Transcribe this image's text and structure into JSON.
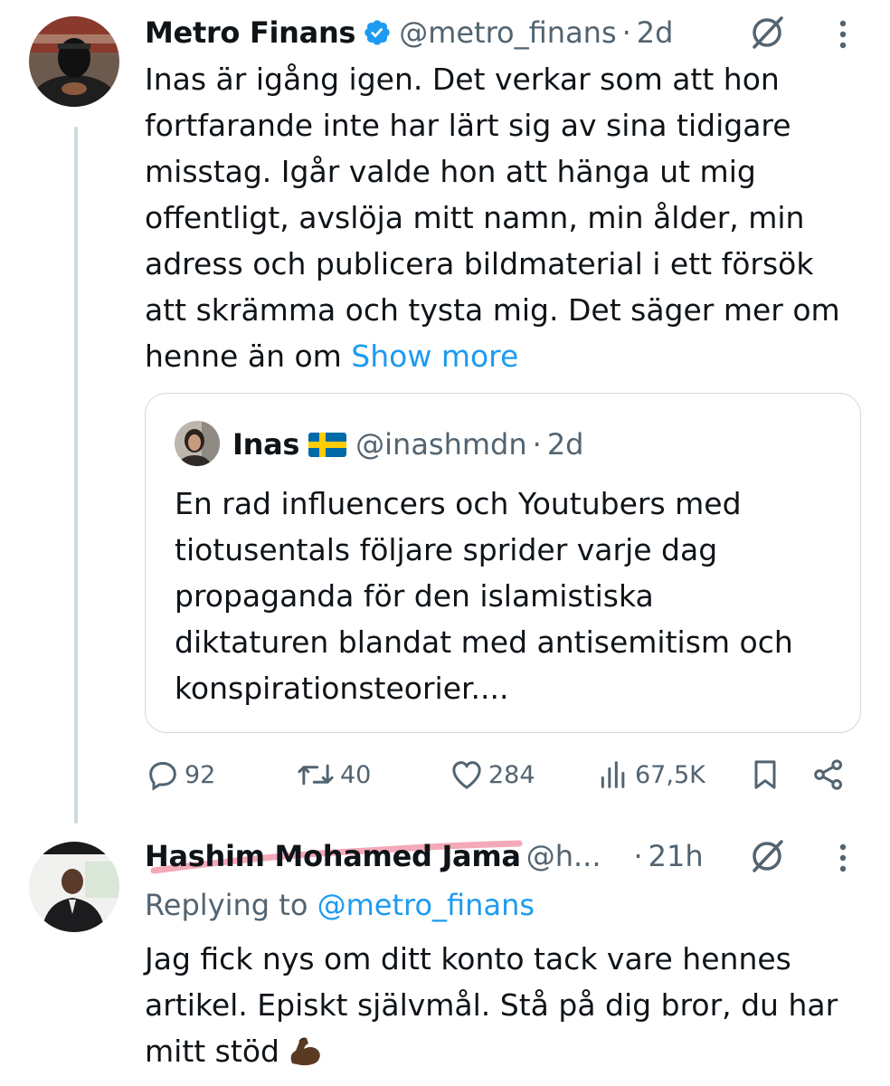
{
  "colors": {
    "link": "#1d9bf0",
    "secondary_text": "#536471",
    "primary_text": "#0f1419",
    "border": "#cfd9de",
    "highlight": "#f08ca0"
  },
  "tweet1": {
    "display_name": "Metro Finans",
    "handle": "@metro_finans",
    "dot": "·",
    "timestamp": "2d",
    "avatar_icon": "masked-person-avatar",
    "body": "Inas är igång igen. Det verkar som att hon\nfortfarande inte har lärt sig av sina tidigare\nmisstag. Igår valde hon att hänga ut mig\noffentligt, avslöja mitt namn, min ålder, min\nadress och publicera bildmaterial i ett försök\natt skrämma och tysta mig. Det säger mer om\nhenne än om ",
    "show_more": "Show more",
    "quote": {
      "display_name": "Inas",
      "flag": "swedish-flag",
      "handle": "@inashmdn",
      "dot": "·",
      "timestamp": "2d",
      "body": "En rad influencers och Youtubers med\ntiotusentals följare sprider varje dag\npropaganda för den islamistiska\ndiktaturen blandat med antisemitism och\nkonspirationsteorier...."
    },
    "actions": {
      "replies": "92",
      "reposts": "40",
      "likes": "284",
      "views": "67,5K"
    }
  },
  "tweet2": {
    "display_name": "Hashim Mohamed Jama",
    "handle": "@h...",
    "dot": "·",
    "timestamp": "21h",
    "replying_prefix": "Replying to ",
    "replying_to": "@metro_finans",
    "body": "Jag fick nys om ditt konto tack vare hennes\nartikel. Episkt självmål. Stå på dig bror, du har\nmitt stöd",
    "emoji": "flexed-biceps-emoji"
  }
}
